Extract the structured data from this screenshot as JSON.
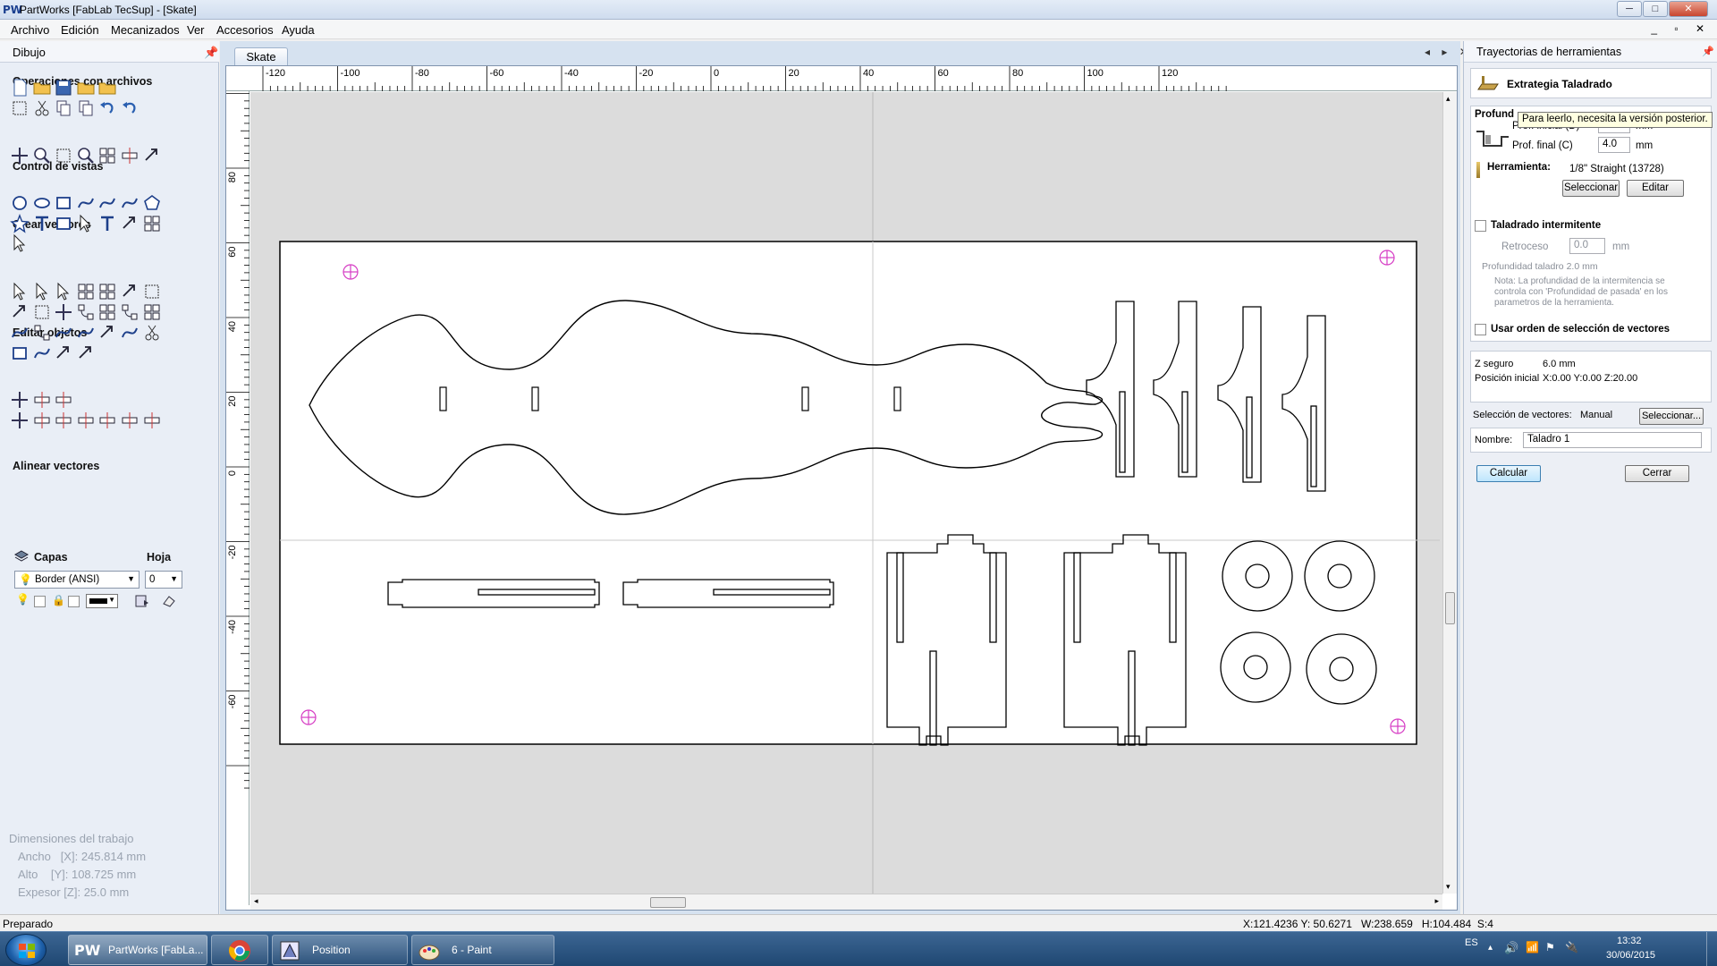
{
  "window": {
    "app_logo": "PW",
    "title": "PartWorks [FabLab TecSup] - [Skate]",
    "controls": {
      "minimize": "─",
      "maximize": "□",
      "close": "✕"
    }
  },
  "menu": [
    "Archivo",
    "Edición",
    "Mecanizados",
    "Ver",
    "Accesorios",
    "Ayuda"
  ],
  "mdi_controls": "_ ▫ ✕",
  "left_panel": {
    "title": "Dibujo",
    "pin": "📌",
    "sections": {
      "file_ops": "Operaciones con archivos",
      "view_control": "Control de vistas",
      "create_vectors": "Crear vectores",
      "edit_objects": "Editar objetos",
      "align_vectors": "Alinear vectores",
      "layers": "Capas",
      "sheet": "Hoja"
    },
    "layer_value": "Border (ANSI)",
    "sheet_value": "0",
    "dimensions": {
      "title": "Dimensiones del trabajo",
      "width": "Ancho   [X]: 245.814 mm",
      "height": "Alto    [Y]: 108.725 mm",
      "thickness": "Expesor [Z]: 25.0 mm"
    }
  },
  "document": {
    "tab": "Skate",
    "doc_controls": "◂ ▸ ✕",
    "ruler_x": [
      "-120",
      "-100",
      "-80",
      "-60",
      "-40",
      "-20",
      "0",
      "20",
      "40",
      "60",
      "80",
      "100",
      "120"
    ],
    "ruler_y": [
      "80",
      "60",
      "40",
      "20",
      "0",
      "-20",
      "-40",
      "-60"
    ]
  },
  "right_panel": {
    "title": "Trayectorias de herramientas",
    "pin": "📌",
    "strategy_title": "Extrategia Taladrado",
    "depth_section": "Profund",
    "tooltip": "Para leerlo, necesita la versión posterior.",
    "start_depth_label": "Prof. inicial (D)",
    "start_depth_value": "0.0",
    "end_depth_label": "Prof. final (C)",
    "end_depth_value": "4.0",
    "unit_mm": "mm",
    "tool_label": "Herramienta:",
    "tool_value": "1/8\" Straight (13728)",
    "select_btn": "Seleccionar",
    "edit_btn": "Editar",
    "peck_label": "Taladrado intermitente",
    "retract_label": "Retroceso",
    "retract_value": "0.0",
    "drill_depth": "Profundidad taladro 2.0 mm",
    "note": "Nota: La profundidad de la intermitencia se controla con 'Profundidad de pasada' en los parametros de la herramienta.",
    "use_order_label": "Usar orden de selección de vectores",
    "safe_z_label": "Z seguro",
    "safe_z_value": "6.0 mm",
    "home_label": "Posición inicial",
    "home_value": "X:0.00 Y:0.00 Z:20.00",
    "vector_sel_label": "Selección de vectores:",
    "vector_sel_mode": "Manual",
    "vector_sel_btn": "Seleccionar...",
    "name_label": "Nombre:",
    "name_value": "Taladro 1",
    "calc_btn": "Calcular",
    "close_btn": "Cerrar"
  },
  "status": {
    "left": "Preparado",
    "coords": "X:121.4236 Y: 50.6271",
    "size": "W:238.659   H:104.484  S:4"
  },
  "taskbar": {
    "tasks": [
      "PartWorks [FabLa...",
      "",
      "Position",
      "6 - Paint"
    ],
    "lang": "ES",
    "time": "13:32",
    "date": "30/06/2015"
  }
}
